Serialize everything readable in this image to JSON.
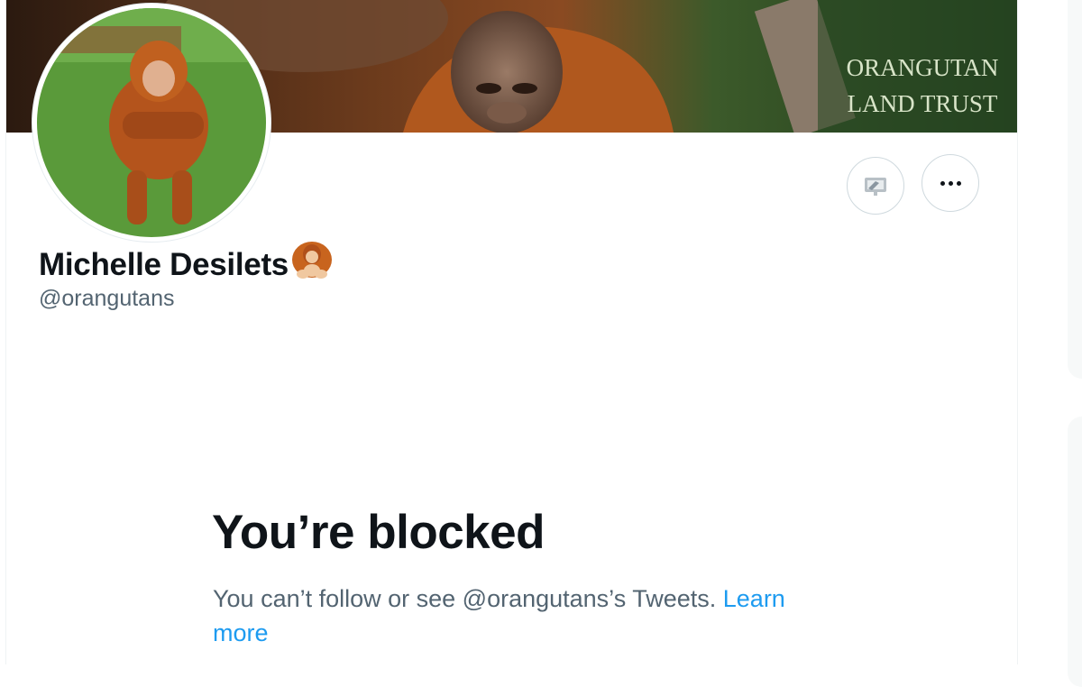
{
  "profile": {
    "display_name": "Michelle Desilets",
    "handle": "@orangutans",
    "name_emoji_icon": "orangutan-emoji-icon"
  },
  "banner": {
    "watermark_line1": "ORANGUTAN",
    "watermark_line2": "LAND TRUST"
  },
  "actions": {
    "suggest_icon": "flag-edit-icon",
    "more_icon": "more-dots-icon"
  },
  "blocked": {
    "title": "You’re blocked",
    "message": "You can’t follow or see @orangutans’s Tweets.",
    "link_label": "Learn more"
  },
  "colors": {
    "link": "#1d9bf0",
    "secondary_text": "#536471",
    "primary_text": "#0f1419"
  }
}
